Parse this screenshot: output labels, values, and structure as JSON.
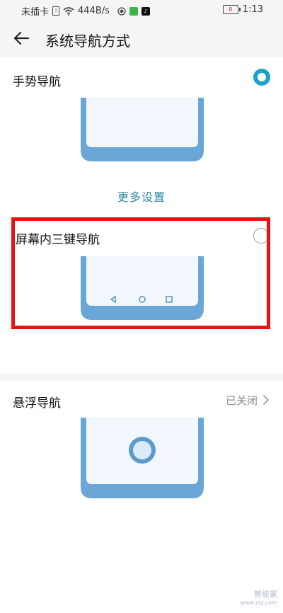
{
  "status_bar": {
    "carrier": "未插卡",
    "speed": "444B/s",
    "battery": "8",
    "time": "1:13"
  },
  "header": {
    "title": "系统导航方式",
    "back_icon": "back-arrow-icon"
  },
  "options": [
    {
      "label": "手势导航",
      "selected": true
    },
    {
      "label": "屏幕内三键导航",
      "selected": false
    },
    {
      "label": "悬浮导航",
      "status": "已关闭"
    }
  ],
  "more_settings": "更多设置",
  "colors": {
    "accent": "#1aa3c8",
    "link": "#2a88a6",
    "phone_frame": "#6aa6d6",
    "phone_screen": "#f1f7fd",
    "highlight": "#e61414"
  },
  "watermark": {
    "line1": "智能家",
    "line2": "www.znj.com"
  }
}
